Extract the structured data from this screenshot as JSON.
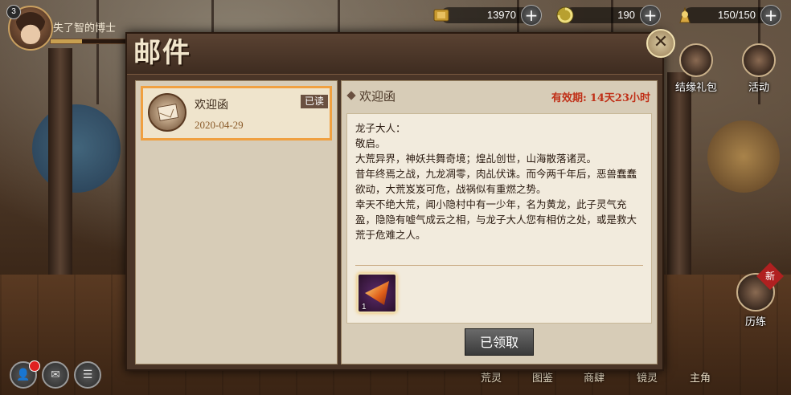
{
  "player": {
    "level": "3",
    "name": "失了智的博士",
    "exp_fraction": 0.4
  },
  "resources": [
    {
      "icon": "gold-coin-icon",
      "value": "13970"
    },
    {
      "icon": "swirl-crystal-icon",
      "value": "190"
    },
    {
      "icon": "stamina-icon",
      "value": "150/150"
    }
  ],
  "side_menu": {
    "gift_pack": "结缘礼包",
    "activity": "活动",
    "training": "历练",
    "new_badge": "新"
  },
  "bottom_menu": {
    "tabs": [
      "荒灵",
      "图鉴",
      "商肆",
      "镜灵",
      "主角"
    ]
  },
  "mail": {
    "title": "邮件",
    "items": [
      {
        "subject": "欢迎函",
        "date": "2020-04-29",
        "status": "已读"
      }
    ],
    "detail": {
      "subject": "欢迎函",
      "validity_label": "有效期:",
      "validity_value": "14天23小时",
      "body": [
        "龙子大人：",
        "敬启。",
        "大荒异界，神妖共舞奇境；煌乩创世，山海散落诸灵。",
        "昔年终焉之战，九龙凋零，肉乩伏诛。而今两千年后，恶兽蠢蠢欲动，大荒岌岌可危，战祸似有重燃之势。",
        "幸天不绝大荒，闻小隐村中有一少年，名为黄龙，此子灵气充盈，隐隐有嘘气成云之相，与龙子大人您有相仿之处，或是救大荒于危难之人。"
      ],
      "reward_qty": "1",
      "claim_button": "已领取"
    }
  },
  "colors": {
    "accent": "#f0a040",
    "validity": "#c03018",
    "panel": "#4a3527"
  }
}
